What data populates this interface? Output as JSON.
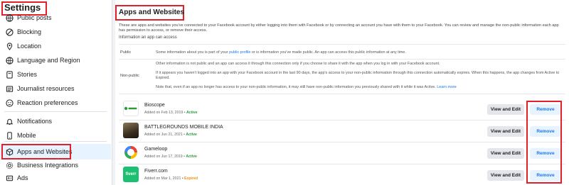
{
  "sidebar": {
    "title": "Settings",
    "items": [
      {
        "label": "Public posts",
        "icon": "globe-icon"
      },
      {
        "label": "Blocking",
        "icon": "block-icon"
      },
      {
        "label": "Location",
        "icon": "location-pin-icon"
      },
      {
        "label": "Language and Region",
        "icon": "globe-icon"
      },
      {
        "label": "Stories",
        "icon": "stories-icon"
      },
      {
        "label": "Journalist resources",
        "icon": "newspaper-icon"
      },
      {
        "label": "Reaction preferences",
        "icon": "reaction-icon"
      },
      {
        "label": "Notifications",
        "icon": "bell-icon"
      },
      {
        "label": "Mobile",
        "icon": "mobile-icon"
      },
      {
        "label": "Apps and Websites",
        "icon": "cube-icon"
      },
      {
        "label": "Business Integrations",
        "icon": "gear-icon"
      },
      {
        "label": "Ads",
        "icon": "ads-icon"
      }
    ]
  },
  "main": {
    "title": "Apps and Websites",
    "description": "These are apps and websites you've connected to your Facebook account by either logging into them with Facebook or by connecting an account you have with them to your Facebook. You can review and manage the non-public information each app has permission to access, or remove their access.",
    "subheading": "Information an app can access",
    "public": {
      "label": "Public",
      "text_before": "Some information about you is part of your ",
      "link": "public profile",
      "text_after": " or is information you've made public. An app can access this public information at any time."
    },
    "non_public": {
      "label": "Non-public",
      "p1": "Other information is not public and an app can access it through this connection only if you choose to share it with the app when you log in with your Facebook account.",
      "p2": "If it appears you haven't logged into an app with your Facebook account in the last 90 days, the app's access to your non-public information through this connection automatically expires. When this happens, the app changes from Active to Expired.",
      "p3": "Note that, even if an app no longer has access to your non-public information, it may still have non-public information you previously shared with it while it was Active.",
      "learn_more": "Learn more"
    },
    "apps": [
      {
        "name": "Bioscope",
        "added": "Added on Feb 13, 2019",
        "status": "Active",
        "logo_text": "Bioscope",
        "logo_color": "#2e9a3e"
      },
      {
        "name": "BATTLEGROUNDS MOBILE INDIA",
        "added": "Added on Jun 21, 2021",
        "status": "Active",
        "logo_text": "",
        "logo_color": "#4a3c2c"
      },
      {
        "name": "Gameloop",
        "added": "Added on Jun 17, 2019",
        "status": "Active",
        "logo_text": "",
        "logo_color": "#ffffff"
      },
      {
        "name": "Fiverr.com",
        "added": "Added on Mar 1, 2021",
        "status": "Expired",
        "logo_text": "fiverr",
        "logo_color": "#1dbf73"
      }
    ],
    "view_edit_label": "View and Edit",
    "remove_label": "Remove"
  },
  "colors": {
    "accent": "#1877f2",
    "highlight": "#e0202a",
    "active": "#2e9a3e",
    "expired": "#e8950c"
  }
}
